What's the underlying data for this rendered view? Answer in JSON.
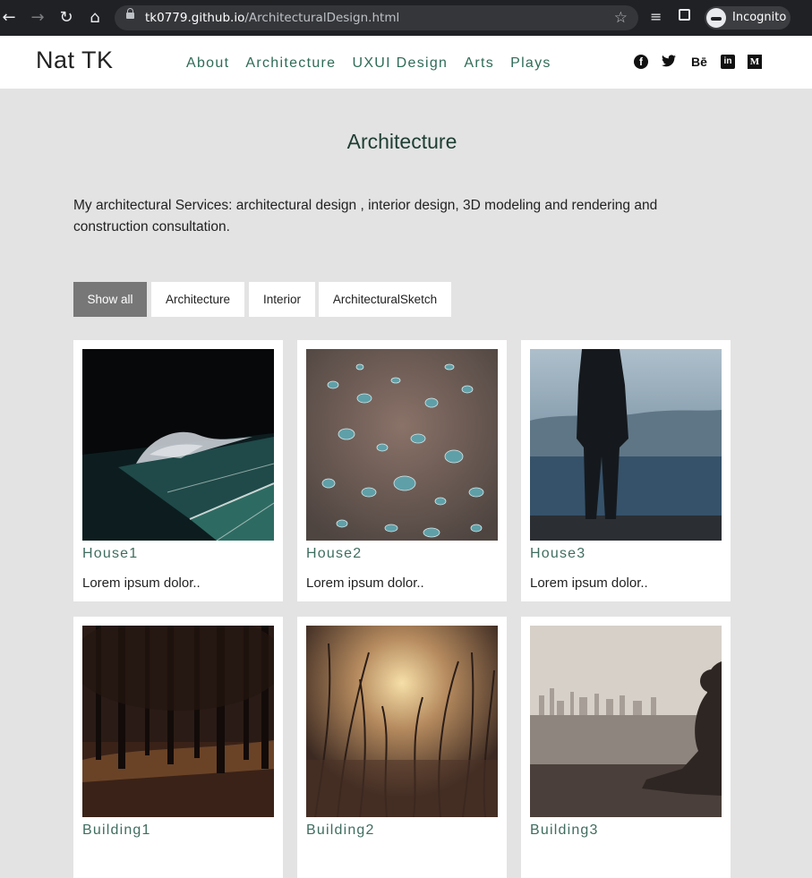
{
  "browser": {
    "url_host": "tk0779.github.io",
    "url_path": "/ArchitecturalDesign.html",
    "profile_label": "Incognito"
  },
  "header": {
    "logo": "Nat TK",
    "nav": [
      "About",
      "Architecture",
      "UXUI Design",
      "Arts",
      "Plays"
    ],
    "social": [
      "facebook-icon",
      "twitter-icon",
      "behance-icon",
      "linkedin-icon",
      "medium-icon"
    ],
    "behance_text": "Bē",
    "linkedin_text": "in",
    "medium_text": "M"
  },
  "main": {
    "title": "Architecture",
    "intro": "My architectural Services: architectural design , interior design, 3D modeling and rendering and construction consultation.",
    "filters": [
      {
        "label": "Show all",
        "active": true
      },
      {
        "label": "Architecture",
        "active": false
      },
      {
        "label": "Interior",
        "active": false
      },
      {
        "label": "ArchitecturalSketch",
        "active": false
      }
    ],
    "cards": [
      {
        "title": "House1",
        "desc": "Lorem ipsum dolor.."
      },
      {
        "title": "House2",
        "desc": "Lorem ipsum dolor.."
      },
      {
        "title": "House3",
        "desc": "Lorem ipsum dolor.."
      },
      {
        "title": "Building1",
        "desc": ""
      },
      {
        "title": "Building2",
        "desc": ""
      },
      {
        "title": "Building3",
        "desc": ""
      }
    ]
  },
  "colors": {
    "page_bg": "#e3e3e3",
    "nav_link": "#2f6b58",
    "active_filter": "#777777"
  }
}
